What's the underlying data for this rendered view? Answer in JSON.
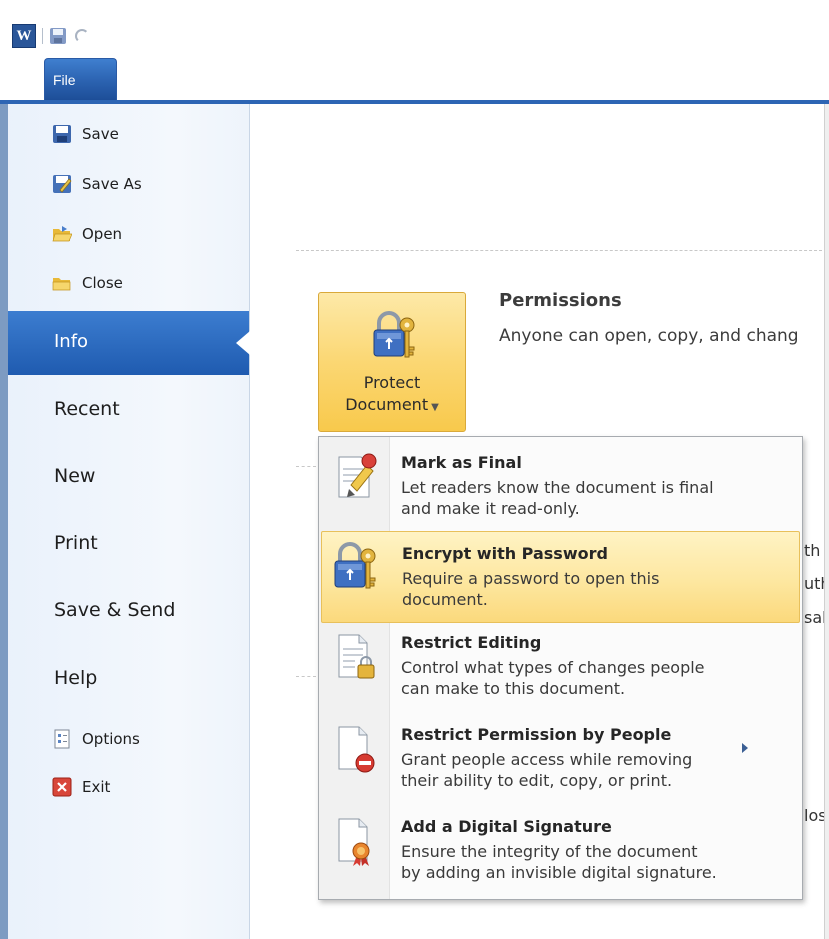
{
  "ribbon": {
    "file_tab_label": "File",
    "app_logo_letter": "W"
  },
  "backstage": {
    "commands_top": [
      {
        "label": "Save",
        "icon": "save-icon"
      },
      {
        "label": "Save As",
        "icon": "save-as-icon"
      },
      {
        "label": "Open",
        "icon": "open-folder-icon"
      },
      {
        "label": "Close",
        "icon": "close-folder-icon"
      }
    ],
    "tabs": [
      {
        "label": "Info",
        "selected": true
      },
      {
        "label": "Recent"
      },
      {
        "label": "New"
      },
      {
        "label": "Print"
      },
      {
        "label": "Save & Send"
      },
      {
        "label": "Help"
      }
    ],
    "commands_bottom": [
      {
        "label": "Options",
        "icon": "options-icon"
      },
      {
        "label": "Exit",
        "icon": "exit-icon"
      }
    ]
  },
  "info": {
    "protect_button": {
      "line1": "Protect",
      "line2": "Document",
      "icon": "lock-key-icon"
    },
    "permissions_title": "Permissions",
    "permissions_desc": "Anyone can open, copy, and chang",
    "peek_text": [
      "th",
      "uth",
      "sab",
      "los"
    ]
  },
  "protect_menu": {
    "items": [
      {
        "title": "Mark as Final",
        "desc_1": "Let readers know the document is final",
        "desc_2": "and make it read-only.",
        "icon": "mark-final-icon"
      },
      {
        "title": "Encrypt with Password",
        "desc_1": "Require a password to open this",
        "desc_2": "document.",
        "icon": "lock-key-icon",
        "highlighted": true
      },
      {
        "title": "Restrict Editing",
        "desc_1": "Control what types of changes people",
        "desc_2": "can make to this document.",
        "icon": "restrict-editing-icon"
      },
      {
        "title": "Restrict Permission by People",
        "desc_1": "Grant people access while removing",
        "desc_2": "their ability to edit, copy, or print.",
        "icon": "restrict-permission-icon",
        "has_submenu": true
      },
      {
        "title": "Add a Digital Signature",
        "desc_1": "Ensure the integrity of the document",
        "desc_2": "by adding an invisible digital signature.",
        "icon": "digital-signature-icon"
      }
    ]
  },
  "colors": {
    "selected_tab": "#2b62b0",
    "hover_highlight": "#fde7a0",
    "protect_button": "#fbd773"
  }
}
